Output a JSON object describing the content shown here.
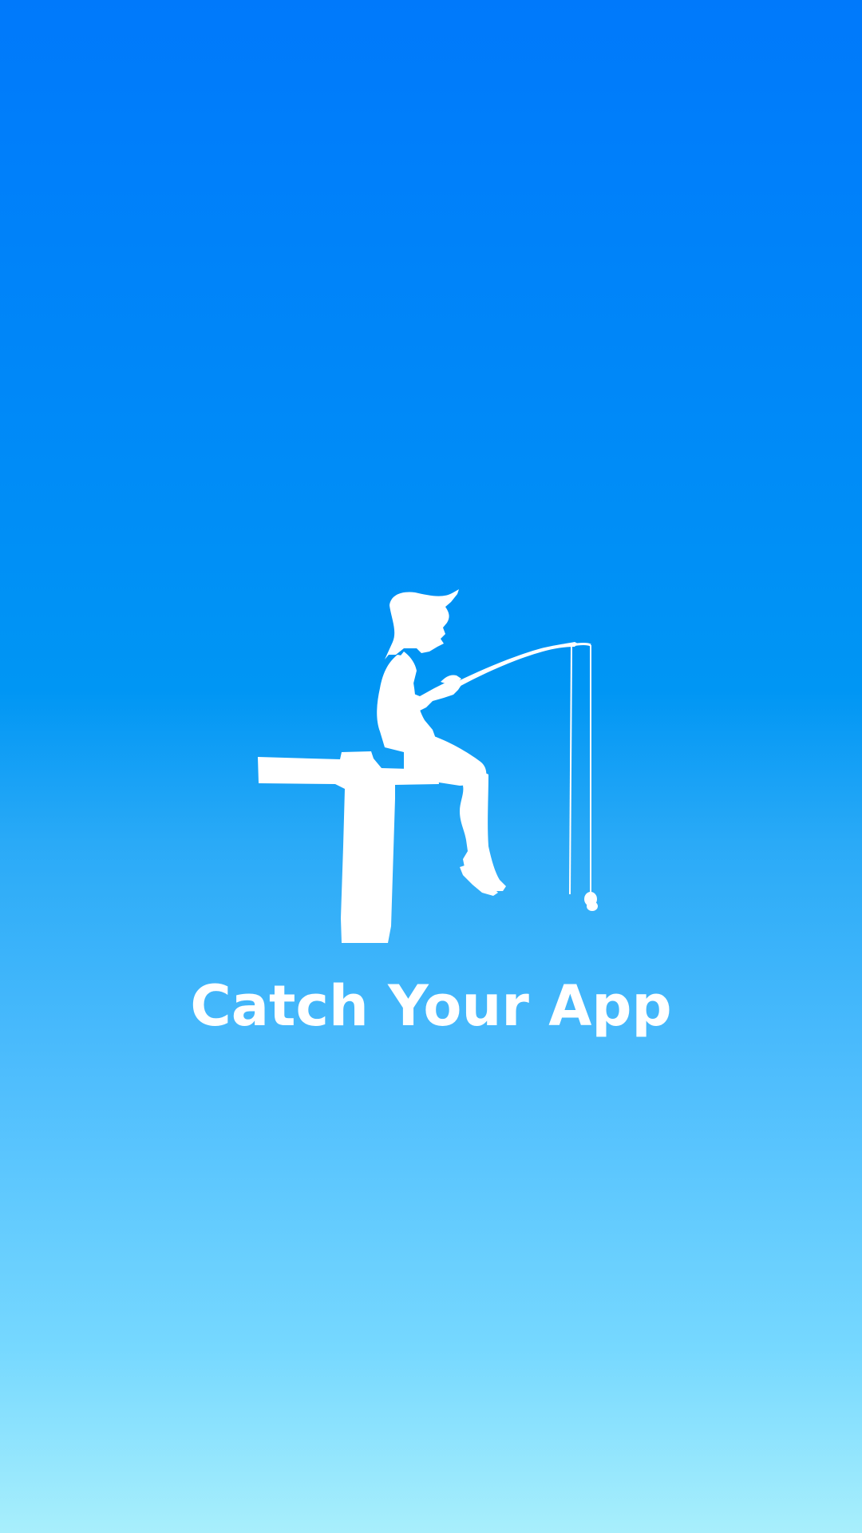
{
  "screen": {
    "name": "splash",
    "background_gradient": [
      "#0079fb",
      "#0096f4",
      "#4ebdfd",
      "#a8effc"
    ]
  },
  "logo": {
    "icon": "boy-fishing-icon",
    "color": "#ffffff"
  },
  "app_name": "Catch Your App"
}
